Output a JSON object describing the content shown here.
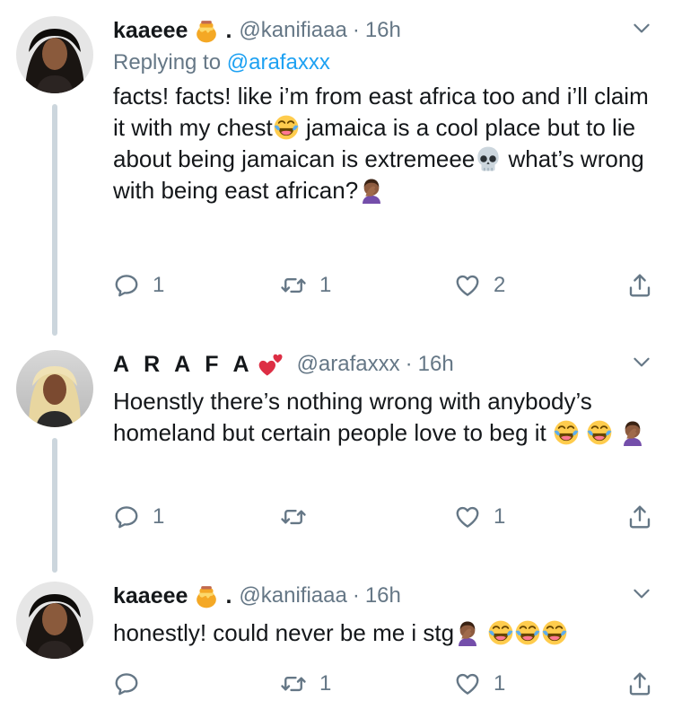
{
  "tweets": [
    {
      "name": "kaaeee",
      "name_emoji": "honey-pot-icon",
      "name_suffix": ".",
      "handle": "@kanifiaaa",
      "dot": "·",
      "time": "16h",
      "replying_prefix": "Replying to",
      "replying_to": "@arafaxxx",
      "text_parts": [
        "facts! facts! like i’m from east africa too and i’ll claim it with my chest",
        " jamaica is a cool place but to lie about being jamaican is extremeee",
        " what’s wrong with being east african?",
        ""
      ],
      "reply_count": "1",
      "retweet_count": "1",
      "like_count": "2"
    },
    {
      "name": "A R A F A",
      "name_emoji": "two-hearts-icon",
      "handle": "@arafaxxx",
      "dot": "·",
      "time": "16h",
      "text_parts": [
        "Hoenstly there’s nothing wrong with anybody’s homeland but certain people love to beg it ",
        " ",
        ""
      ],
      "reply_count": "1",
      "retweet_count": "",
      "like_count": "1"
    },
    {
      "name": "kaaeee",
      "name_emoji": "honey-pot-icon",
      "name_suffix": ".",
      "handle": "@kanifiaaa",
      "dot": "·",
      "time": "16h",
      "text_parts": [
        "honestly! could never be me i stg",
        ""
      ],
      "reply_count": "",
      "retweet_count": "1",
      "like_count": "1"
    }
  ],
  "colors": {
    "text": "#14171a",
    "secondary": "#657786",
    "link": "#1da1f2",
    "thread_line": "#ccd6dd"
  }
}
